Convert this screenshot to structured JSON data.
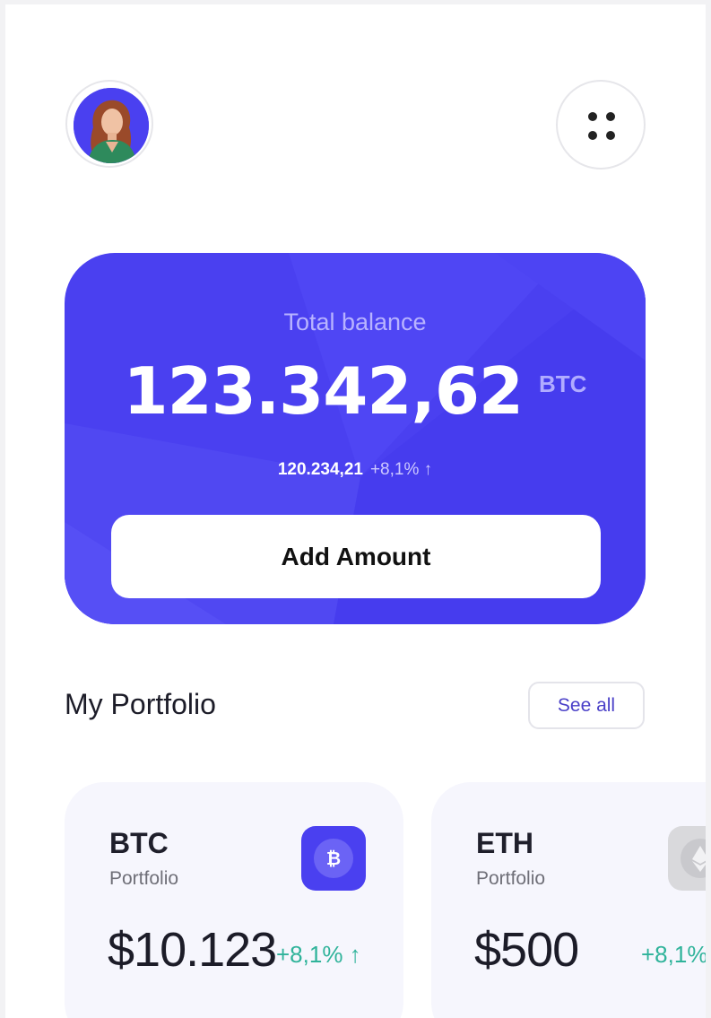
{
  "header": {
    "avatar_alt": "User avatar",
    "menu_icon": "grid-dots-icon"
  },
  "balance_card": {
    "label": "Total balance",
    "value": "123.342,62",
    "unit": "BTC",
    "sub_amount": "120.234,21",
    "sub_change": "+8,1% ↑",
    "button_label": "Add Amount"
  },
  "portfolio": {
    "title": "My Portfolio",
    "see_all_label": "See all",
    "cards": [
      {
        "symbol": "BTC",
        "subtitle": "Portfolio",
        "value": "$10.123",
        "change": "+8,1% ↑",
        "icon": "bitcoin-icon",
        "icon_bg": "#4a40f0"
      },
      {
        "symbol": "ETH",
        "subtitle": "Portfolio",
        "value": "$500",
        "change": "+8,1%",
        "icon": "ethereum-icon",
        "icon_bg": "#d9d9dc"
      }
    ]
  },
  "colors": {
    "accent": "#4a40f0",
    "positive": "#2fb39a"
  }
}
